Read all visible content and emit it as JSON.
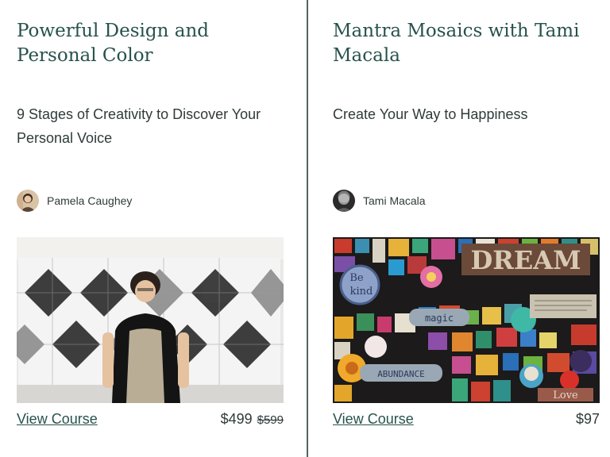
{
  "courses": [
    {
      "title": "Powerful Design and Personal Color",
      "subtitle": "9 Stages of Creativity to Discover Your Personal Voice",
      "author": "Pamela Caughey",
      "link_label": "View Course",
      "price": "$499",
      "original_price": "$599"
    },
    {
      "title": "Mantra Mosaics with Tami Macala",
      "subtitle": "Create Your Way to Happiness",
      "author": "Tami Macala",
      "link_label": "View Course",
      "price": "$97",
      "mosaic_words": [
        "Be",
        "kind",
        "DREAM",
        "magic",
        "ABUNDANCE",
        "Love"
      ]
    }
  ],
  "colors": {
    "accent": "#27524c",
    "divider": "#4d6663",
    "text": "#2f3b3a"
  }
}
